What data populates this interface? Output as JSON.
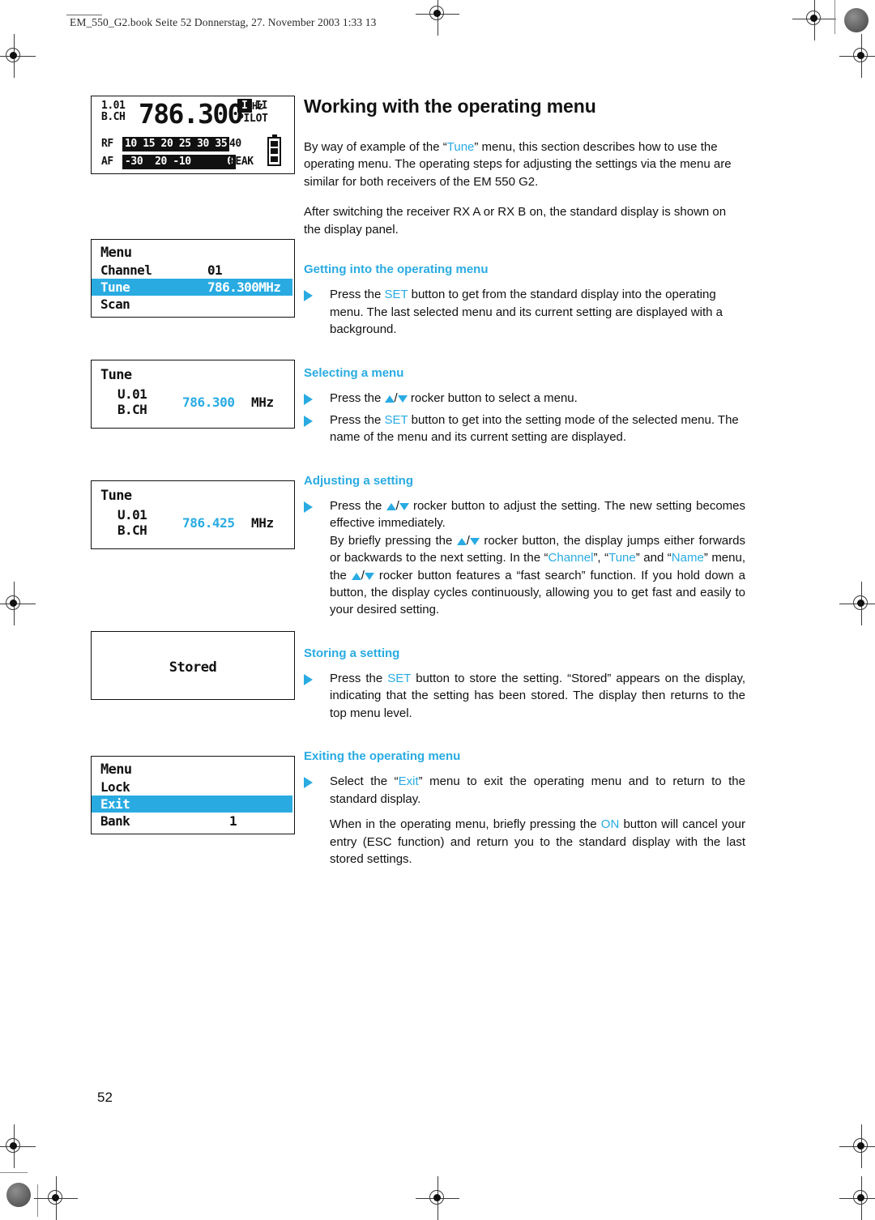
{
  "header": {
    "running_head": "EM_550_G2.book  Seite 52  Donnerstag, 27. November 2003  1:33 13"
  },
  "page": {
    "title": "Working with the operating menu",
    "number": "52"
  },
  "colors": {
    "accent": "#29abe2",
    "text": "#111111",
    "lcd_bg": "#ffffff",
    "lcd_ink": "#111111"
  },
  "intro": {
    "p1_a": "By way of example of the “",
    "p1_link": "Tune",
    "p1_b": "” menu, this section describes how to use the operating menu. The operating steps for adjusting the settings via the menu are similar for both receivers of the EM 550 G2.",
    "p2": "After switching the receiver RX A or RX B on, the standard display is shown on the display panel."
  },
  "sections": {
    "getting_in": {
      "heading": "Getting into the operating menu",
      "bullet1_a": "Press the ",
      "bullet1_key": "SET",
      "bullet1_b": " button to get from the standard display into the operating menu. The last selected menu and its current setting are displayed with a background."
    },
    "selecting": {
      "heading": "Selecting a menu",
      "bullet1_a": "Press the ",
      "bullet1_b": " rocker button to select a menu.",
      "bullet2_a": "Press the ",
      "bullet2_key": "SET",
      "bullet2_b": " button to get into the setting mode of the selected menu. The name of the menu and its current setting are displayed."
    },
    "adjusting": {
      "heading": "Adjusting a setting",
      "b1_a": "Press the ",
      "b1_b": " rocker button to adjust the setting. The new setting becomes effective immediately.",
      "b2_a": "By briefly pressing the ",
      "b2_b": " rocker button, the display jumps either forwards or backwards to the next setting. In the “",
      "b2_link1": "Channel",
      "b2_c": "”, “",
      "b2_link2": "Tune",
      "b2_d": "” and “",
      "b2_link3": "Name",
      "b2_e": "” menu, the ",
      "b2_f": " rocker button features a “fast search” function. If you hold down a button, the display cycles continuously, allowing you to get fast and easily to your desired setting."
    },
    "storing": {
      "heading": "Storing a setting",
      "bullet1_a": "Press the ",
      "bullet1_key": "SET",
      "bullet1_b": " button to store the setting. “Stored” appears on the display, indicating that the setting has been stored. The display then returns to the top menu level."
    },
    "exiting": {
      "heading": "Exiting the operating menu",
      "b1_a": "Select the “",
      "b1_link": "Exit",
      "b1_b": "” menu to exit the operating menu and to return to the standard display.",
      "b2_a": "When in the operating menu, briefly pressing the ",
      "b2_key": "ON",
      "b2_b": " button will cancel your entry (ESC function) and return you to the standard display with the last stored settings."
    }
  },
  "displays": {
    "standard": {
      "channel_num": "1.01",
      "channel_label": "B.CH",
      "frequency": "786.300",
      "unit": "MHz",
      "rom_active": "I",
      "rom_inactive": "II",
      "pilot": "PILOT",
      "rf_label": "RF",
      "rf_scale_active": "10 15 20 25 30 35",
      "rf_scale_rest": "40",
      "af_label": "AF",
      "af_scale_active": "-30  20 -10      0",
      "af_peak": "PEAK"
    },
    "menu_top": {
      "title": "Menu",
      "rows": [
        {
          "label": "Channel",
          "value": "01",
          "selected": false
        },
        {
          "label": "Tune",
          "value": "786.300MHz",
          "selected": true
        },
        {
          "label": "Scan",
          "value": "",
          "selected": false
        }
      ]
    },
    "tune_before": {
      "title": "Tune",
      "line1": "U.01",
      "line2": "B.CH",
      "frequency": "786.300",
      "unit": "MHz"
    },
    "tune_after": {
      "title": "Tune",
      "line1": "U.01",
      "line2": "B.CH",
      "frequency": "786.425",
      "unit": "MHz"
    },
    "stored": {
      "text": "Stored"
    },
    "menu_exit": {
      "title": "Menu",
      "rows": [
        {
          "label": "Lock",
          "value": "",
          "selected": false
        },
        {
          "label": "Exit",
          "value": "",
          "selected": true
        },
        {
          "label": "Bank",
          "value": "1",
          "selected": false
        }
      ]
    }
  }
}
